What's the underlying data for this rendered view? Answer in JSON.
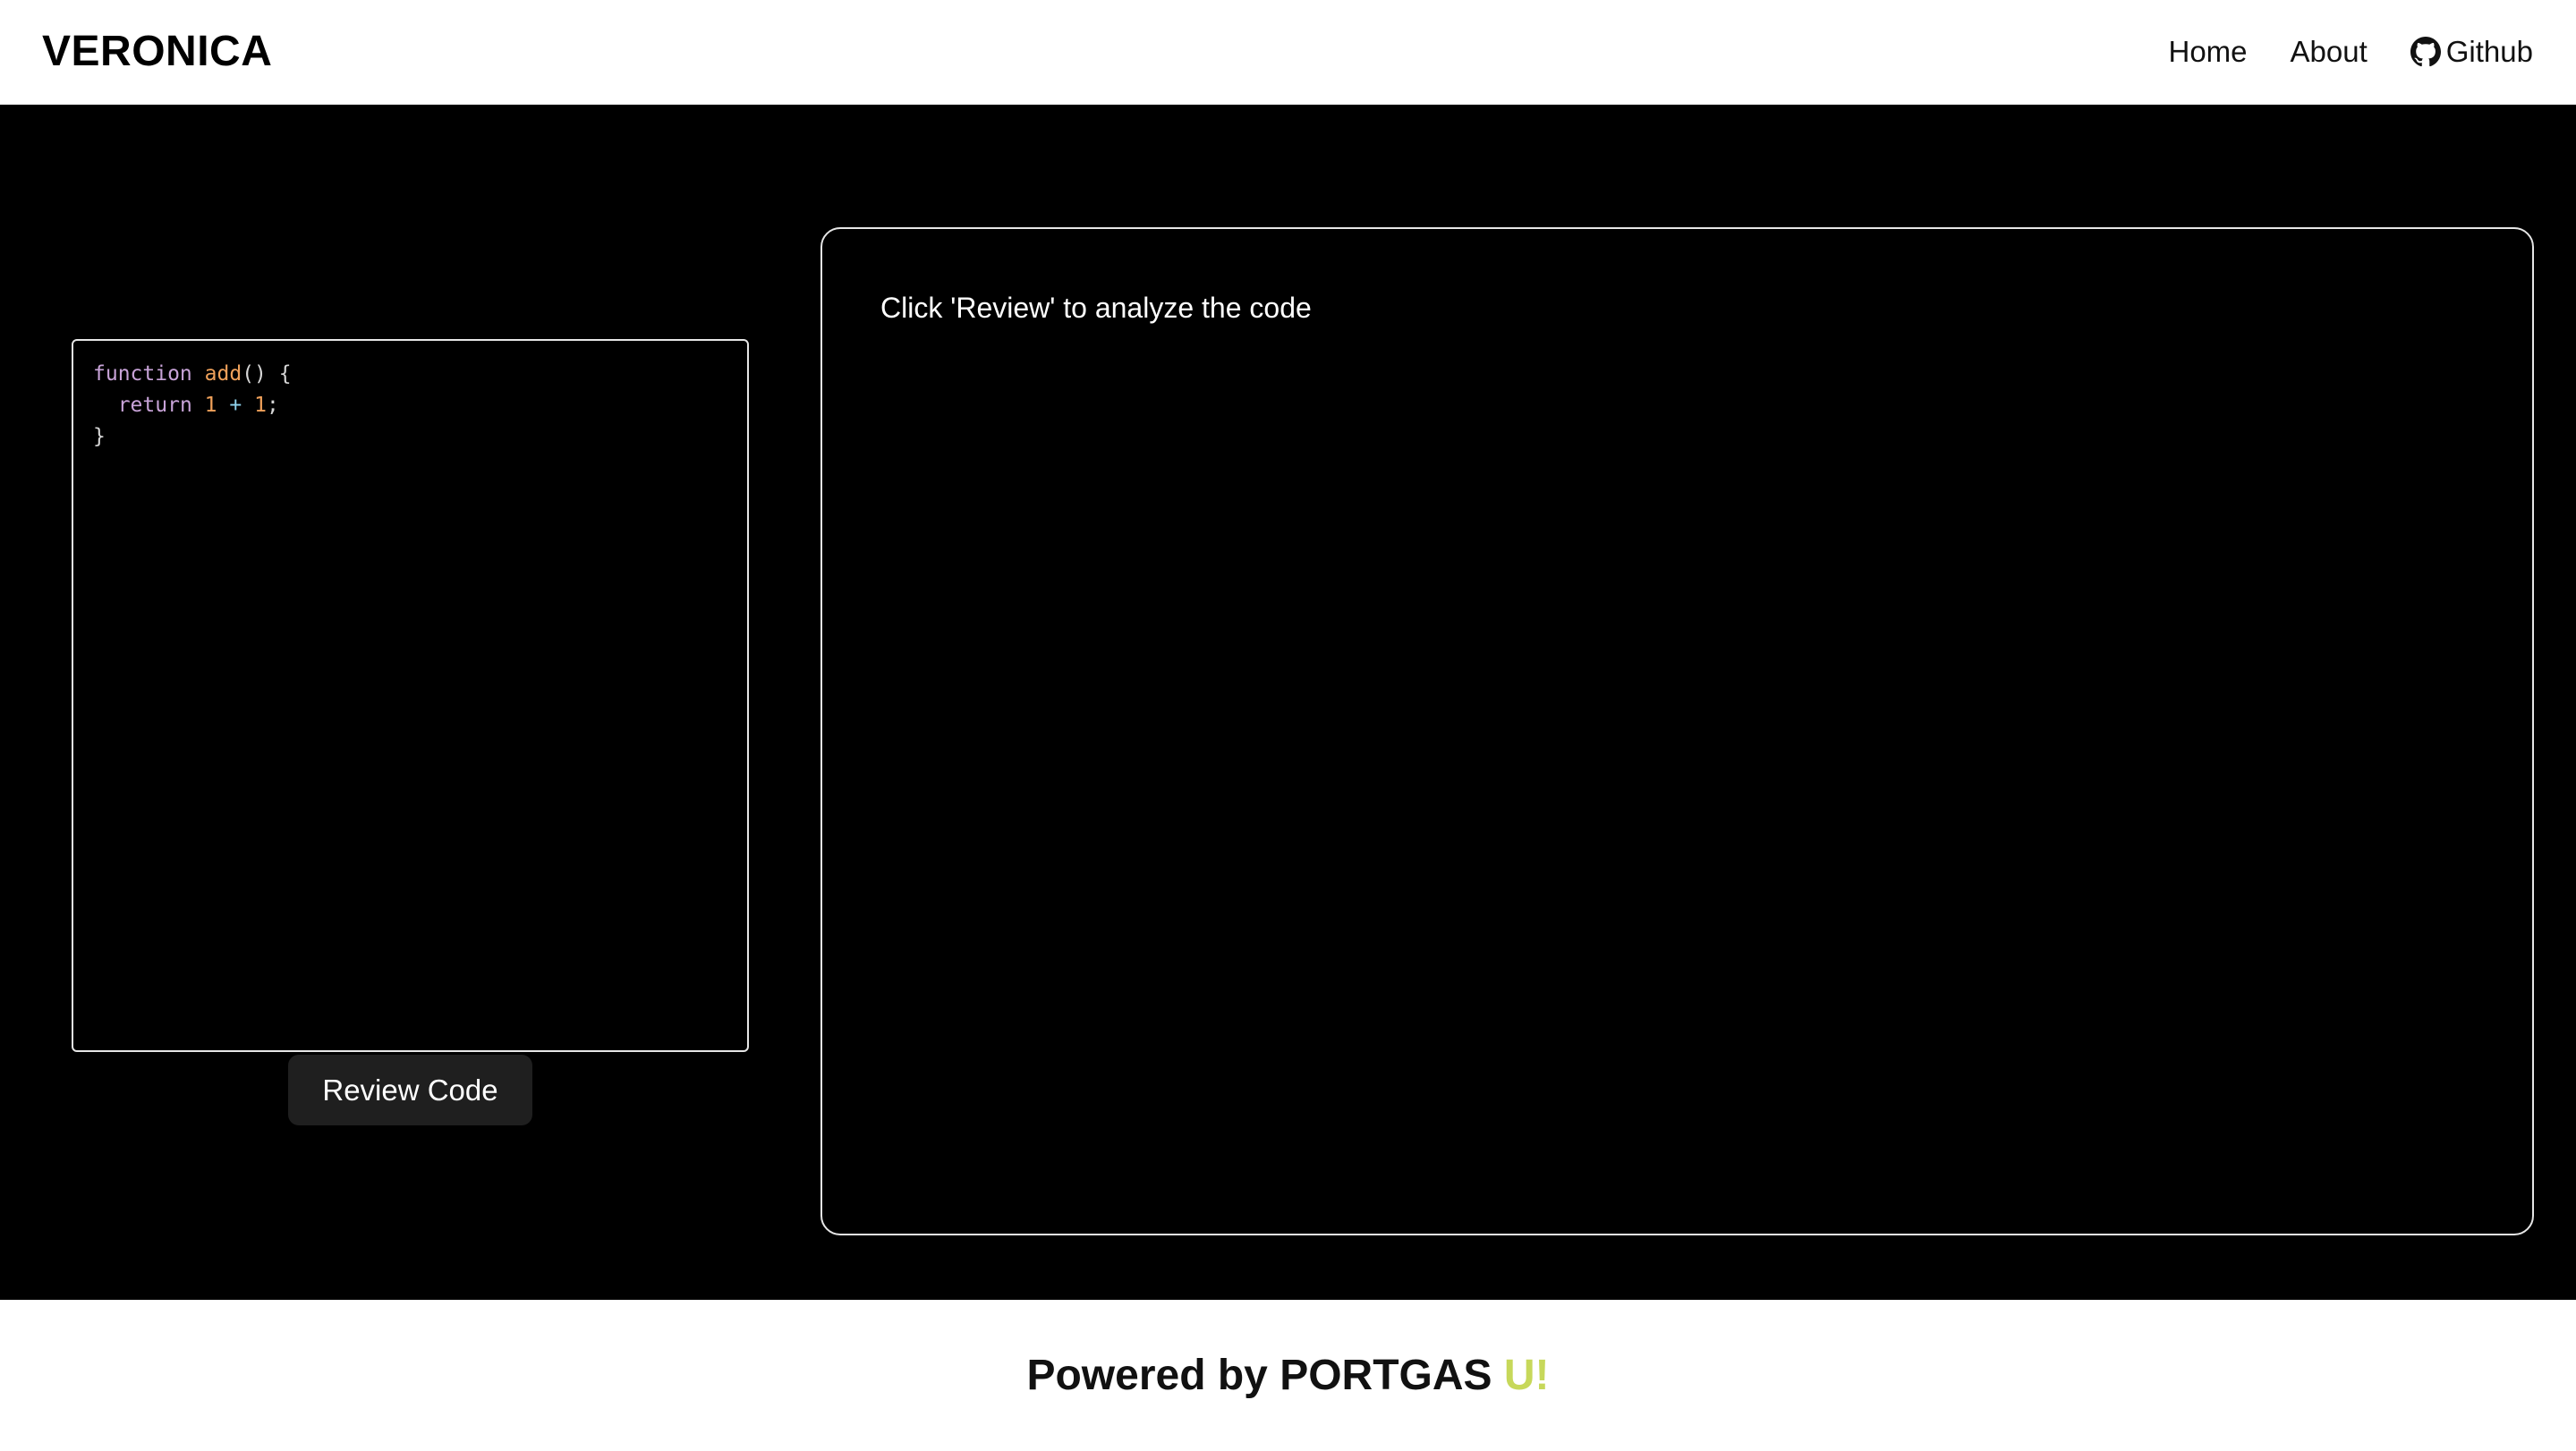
{
  "header": {
    "brand": "VERONICA",
    "nav": {
      "home": "Home",
      "about": "About",
      "github": "Github",
      "github_icon": "github-icon"
    }
  },
  "editor": {
    "lines": [
      [
        "function",
        " ",
        "add",
        "() {"
      ],
      [
        "  ",
        "return",
        " ",
        "1",
        " ",
        "+",
        " ",
        "1",
        ";"
      ],
      [
        "}"
      ]
    ],
    "line_text": [
      "function add() {",
      "  return 1 + 1;",
      "}"
    ]
  },
  "actions": {
    "review_button": "Review Code"
  },
  "review_panel": {
    "placeholder": "Click 'Review' to analyze the code"
  },
  "footer": {
    "text_main": "Powered by PORTGAS ",
    "text_accent": "U!"
  },
  "colors": {
    "background": "#000000",
    "header_bg": "#ffffff",
    "border": "#e6e6e6",
    "button_bg": "#1f1f1f",
    "accent": "#c7d85a",
    "syntax_keyword": "#c8a3d8",
    "syntax_function": "#f0a15a",
    "syntax_number": "#f0a15a",
    "syntax_operator": "#8fd3ee"
  }
}
